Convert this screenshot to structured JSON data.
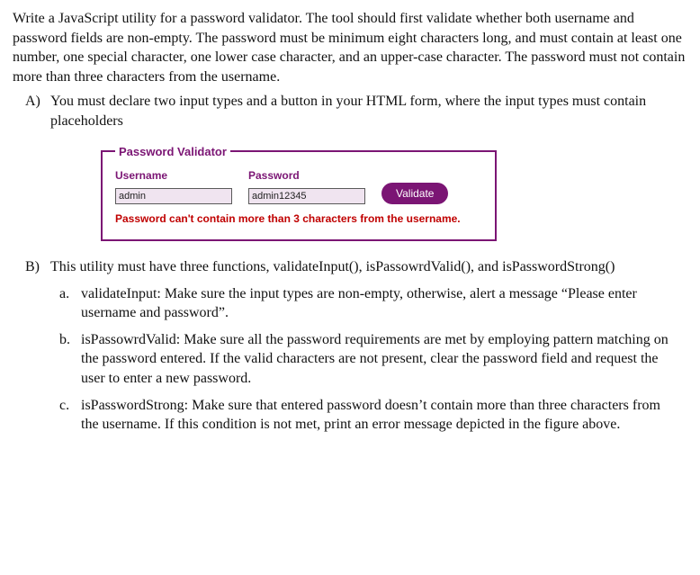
{
  "intro": "Write a JavaScript utility for a password validator. The tool should first validate whether both username and password fields are non-empty. The password must be minimum eight characters long, and must contain at least one number, one special character, one lower case character, and an upper-case character. The password must not contain more than three characters from the username.",
  "A": {
    "label": "A)",
    "text": "You must declare two input types and a button in your HTML form, where the input types must contain placeholders"
  },
  "validator": {
    "legend": "Password Validator",
    "username_label": "Username",
    "password_label": "Password",
    "username_value": "admin",
    "password_value": "admin12345",
    "button_label": "Validate",
    "error_message": "Password can't contain more than 3 characters from the username."
  },
  "B": {
    "label": "B)",
    "text": "This utility must have three functions, validateInput(), isPassowrdValid(), and isPasswordStrong()",
    "a": {
      "label": "a.",
      "text": "validateInput: Make sure the input types are non-empty, otherwise, alert a message “Please enter username and password”."
    },
    "b": {
      "label": "b.",
      "text": "isPassowrdValid: Make sure all the password requirements are met by employing pattern matching on the password entered. If the valid characters are not present, clear the password field and request the user to enter a new password."
    },
    "c": {
      "label": "c.",
      "text": "isPasswordStrong: Make sure that entered password doesn’t contain more than three characters from the username. If this condition is not met, print an error message depicted in the figure above."
    }
  }
}
